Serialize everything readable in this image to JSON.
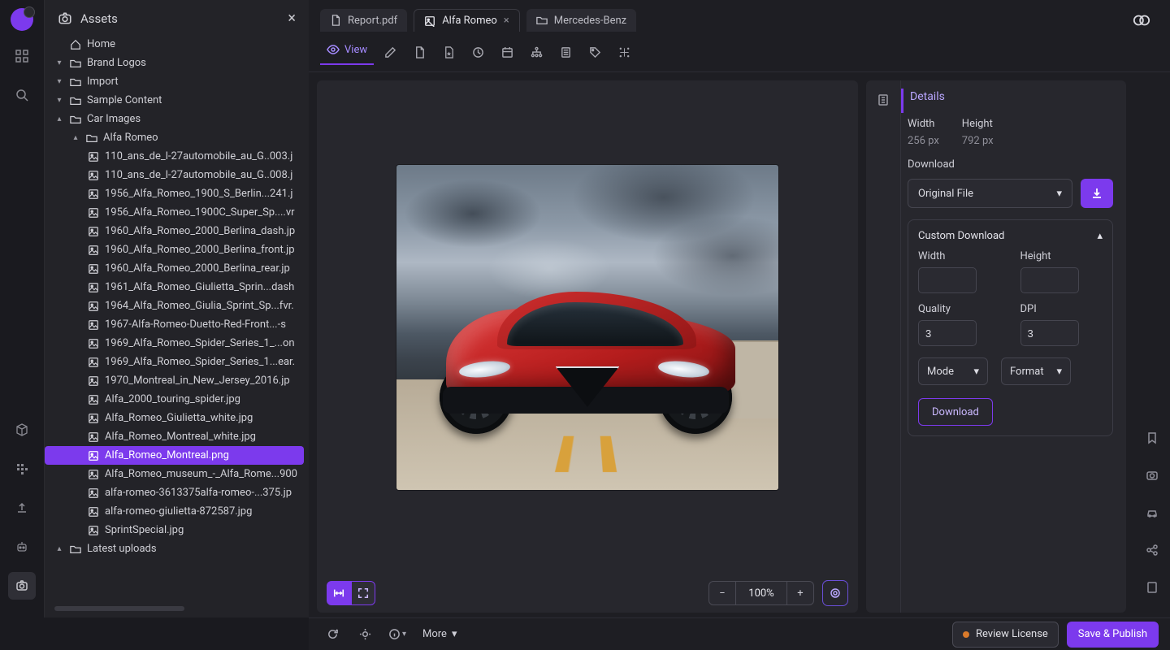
{
  "sidebar": {
    "title": "Assets",
    "home": "Home",
    "folders": {
      "brand_logos": "Brand Logos",
      "import": "Import",
      "sample_content": "Sample Content",
      "car_images": "Car Images",
      "alfa_romeo": "Alfa Romeo",
      "latest_uploads": "Latest uploads"
    },
    "files": [
      "110_ans_de_l-27automobile_au_G..003.j",
      "110_ans_de_l-27automobile_au_G..008.j",
      "1956_Alfa_Romeo_1900_S_Berlin...241.j",
      "1956_Alfa_Romeo_1900C_Super_Sp....vr",
      "1960_Alfa_Romeo_2000_Berlina_dash.jp",
      "1960_Alfa_Romeo_2000_Berlina_front.jp",
      "1960_Alfa_Romeo_2000_Berlina_rear.jp",
      "1961_Alfa_Romeo_Giulietta_Sprin...dash",
      "1964_Alfa_Romeo_Giulia_Sprint_Sp...fvr.",
      "1967-Alfa-Romeo-Duetto-Red-Front...-s",
      "1969_Alfa_Romeo_Spider_Series_1_...on",
      "1969_Alfa_Romeo_Spider_Series_1...ear.",
      "1970_Montreal_in_New_Jersey_2016.jp",
      "Alfa_2000_touring_spider.jpg",
      "Alfa_Romeo_Giulietta_white.jpg",
      "Alfa_Romeo_Montreal_white.jpg",
      "Alfa_Romeo_Montreal.png",
      "Alfa_Romeo_museum_-_Alfa_Rome...900",
      "alfa-romeo-3613375alfa-romeo-...375.jp",
      "alfa-romeo-giulietta-872587.jpg",
      "SprintSpecial.jpg"
    ],
    "selected_index": 16
  },
  "tabs": [
    {
      "icon": "file",
      "label": "Report.pdf",
      "active": false,
      "closable": false
    },
    {
      "icon": "image",
      "label": "Alfa Romeo",
      "active": true,
      "closable": true
    },
    {
      "icon": "folder",
      "label": "Mercedes-Benz",
      "active": false,
      "closable": false
    }
  ],
  "toolbar": {
    "view_label": "View"
  },
  "zoom": {
    "value": "100%"
  },
  "details": {
    "title": "Details",
    "width_label": "Width",
    "height_label": "Height",
    "width_value": "256 px",
    "height_value": "792 px",
    "download_label": "Download",
    "original_file": "Original File",
    "custom_download": "Custom Download",
    "quality_label": "Quality",
    "dpi_label": "DPI",
    "quality_value": "3",
    "dpi_value": "3",
    "mode_label": "Mode",
    "format_label": "Format",
    "download_btn": "Download"
  },
  "footer": {
    "more": "More",
    "review": "Review License",
    "publish": "Save & Publish"
  }
}
